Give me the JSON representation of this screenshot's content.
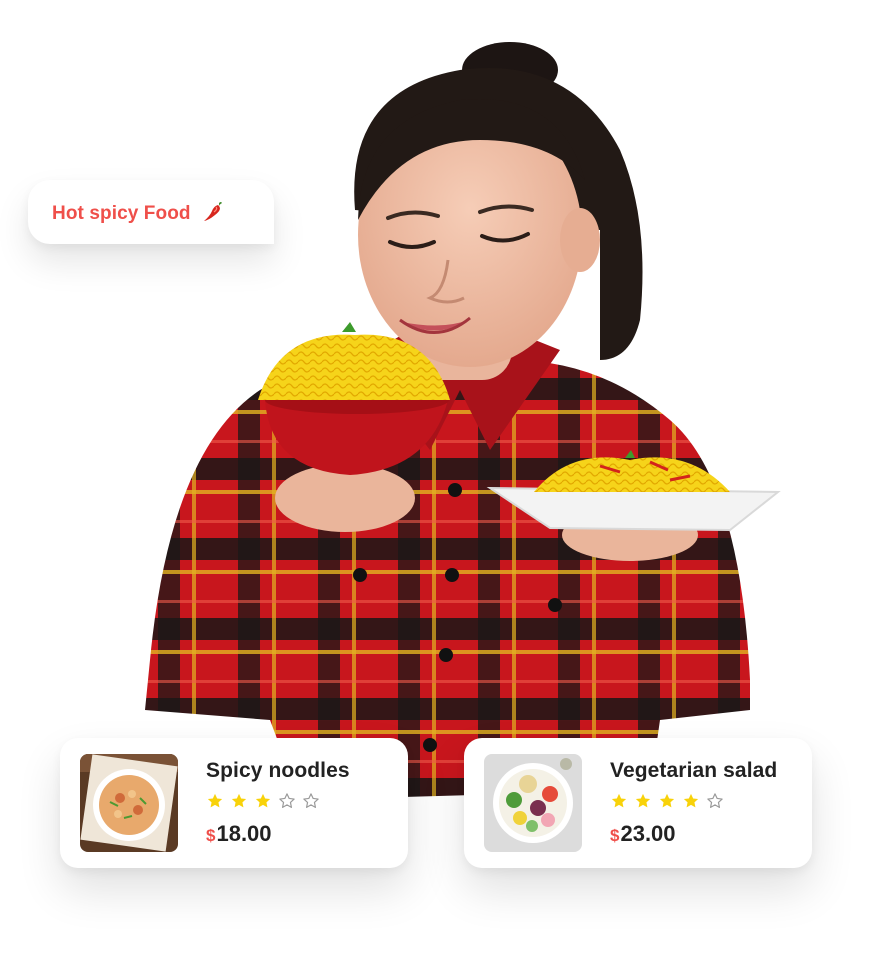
{
  "bubble": {
    "text": "Hot spicy Food",
    "icon": "chili-pepper-icon"
  },
  "hero": {
    "description_icon": "woman-with-noodles-photo"
  },
  "cards": [
    {
      "title": "Spicy noodles",
      "rating": 3,
      "max_rating": 5,
      "currency": "$",
      "price": "18.00",
      "thumb_icon": "spicy-noodles-photo"
    },
    {
      "title": "Vegetarian salad",
      "rating": 4,
      "max_rating": 5,
      "currency": "$",
      "price": "23.00",
      "thumb_icon": "vegetarian-salad-photo"
    }
  ],
  "colors": {
    "accent": "#ef4f4a",
    "star_filled": "#f8d20a",
    "star_empty": "#9a9a9a",
    "text": "#222222"
  }
}
